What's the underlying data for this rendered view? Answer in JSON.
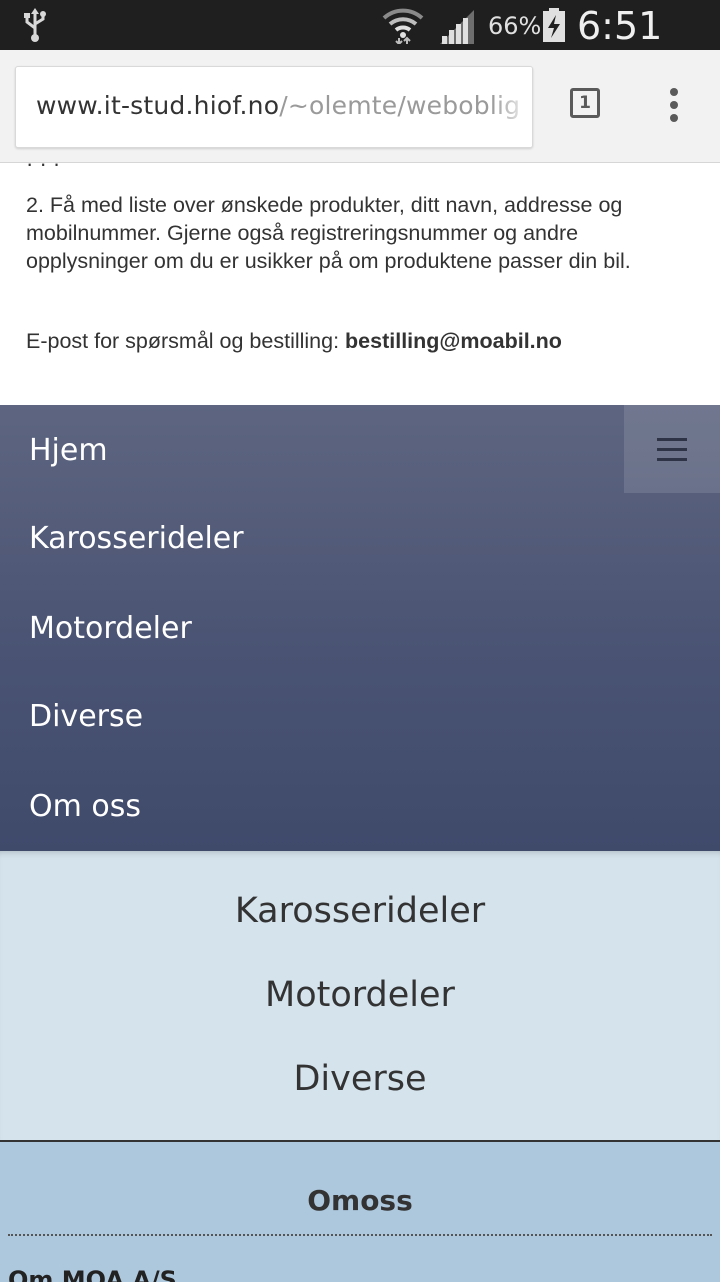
{
  "status_bar": {
    "battery_percent": "66%",
    "time": "6:51 AM",
    "icons": [
      "usb-icon",
      "wifi-icon",
      "signal-icon",
      "battery-charging-icon"
    ]
  },
  "browser": {
    "url_host": "www.it-stud.hiof.no",
    "url_path": "/~olemte/weboblig",
    "tab_count": "1"
  },
  "content": {
    "step2": "2. Få med liste over ønskede produkter, ditt navn, addresse og mobilnummer. Gjerne også registreringsnummer og andre opplysninger om du er usikker på om produktene passer din bil.",
    "email_label": "E-post for spørsmål og bestilling: ",
    "email": "bestilling@moabil.no"
  },
  "nav": {
    "items": [
      "Hjem",
      "Karosserideler",
      "Motordeler",
      "Diverse",
      "Om oss"
    ]
  },
  "categories": {
    "items": [
      "Karosserideler",
      "Motordeler",
      "Diverse"
    ]
  },
  "footer": {
    "heading": "Omoss",
    "subheading": "Om MOA A/S"
  },
  "colors": {
    "nav_top": "#5d6580",
    "nav_bottom": "#3f4a6b",
    "categories_bg": "#d5e3ed",
    "footer_bg": "#adc8dd"
  }
}
